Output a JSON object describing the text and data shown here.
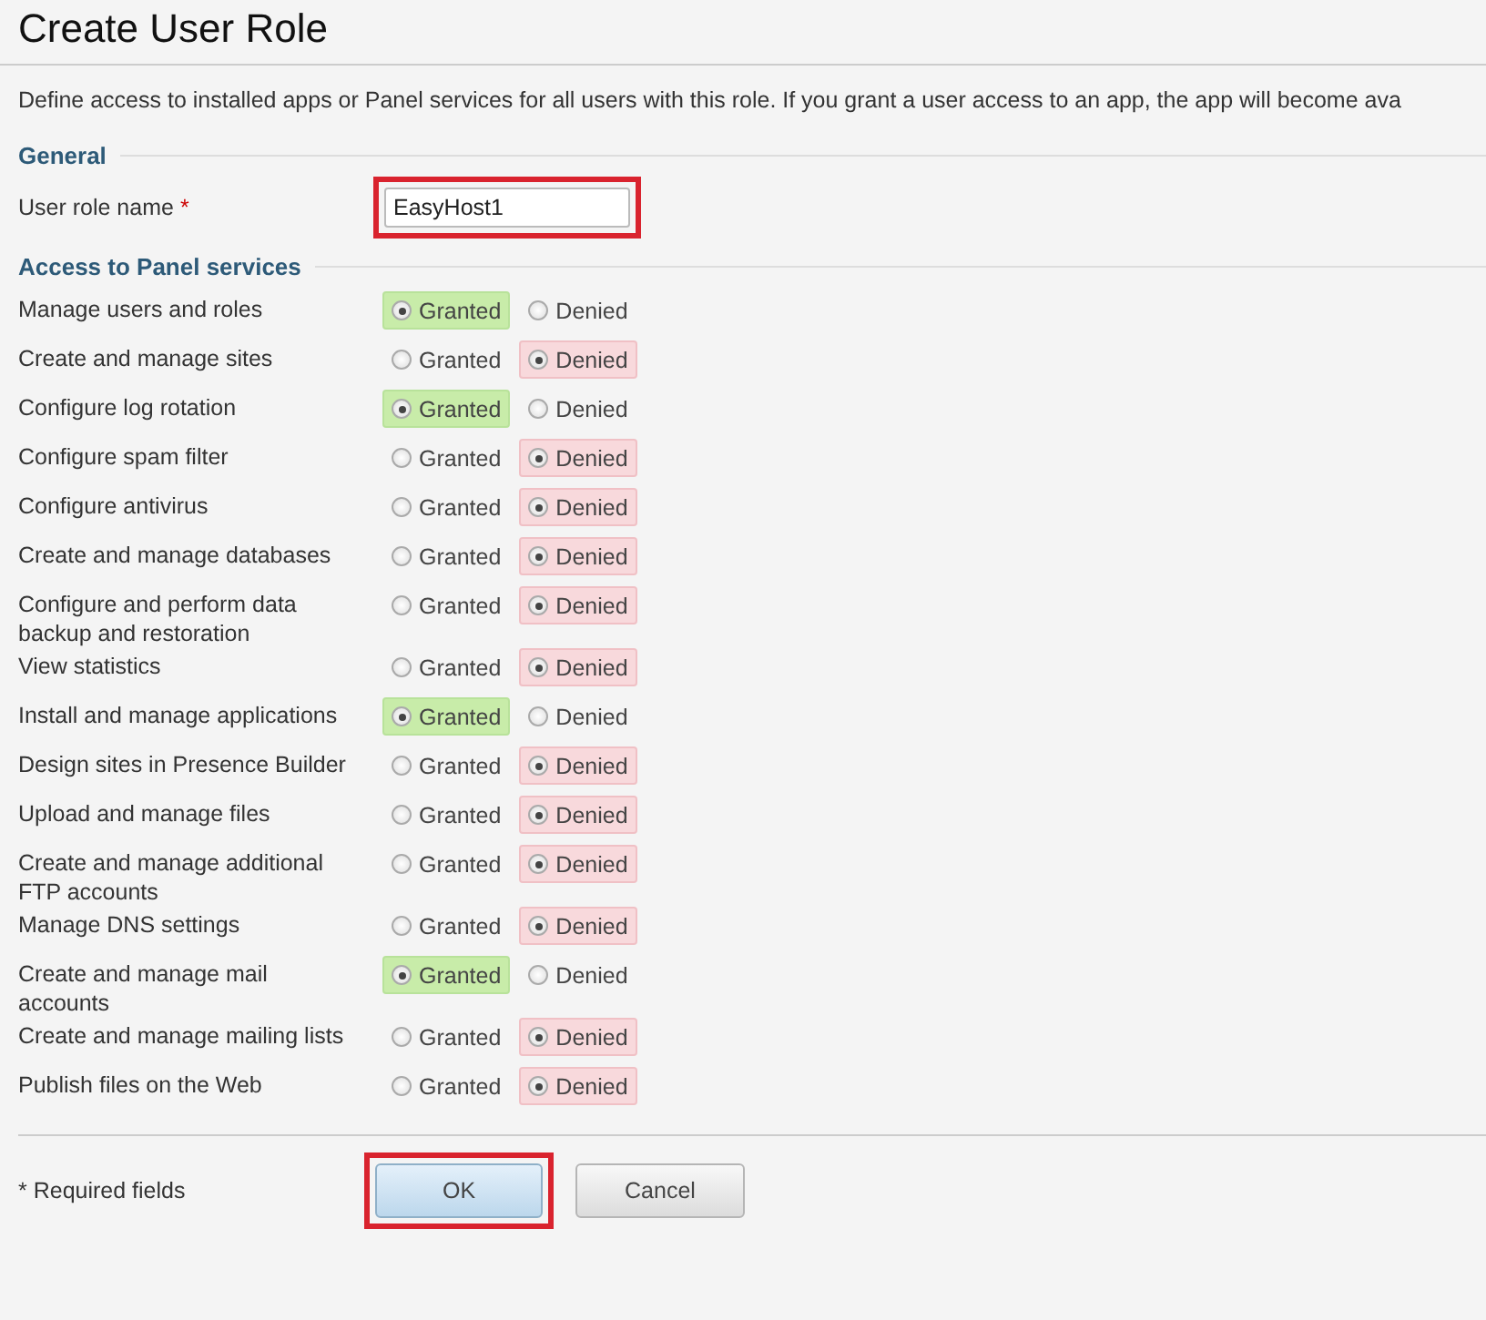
{
  "title": "Create User Role",
  "description": "Define access to installed apps or Panel services for all users with this role. If you grant a user access to an app, the app will become ava",
  "general": {
    "heading": "General",
    "field": {
      "label": "User role name",
      "required_mark": "*",
      "value": "EasyHost1",
      "highlighted": true
    }
  },
  "access": {
    "heading": "Access to Panel services",
    "permissions": [
      {
        "name": "Manage users and roles",
        "options": [
          {
            "label": "Granted",
            "kind": "grant",
            "selected": true
          },
          {
            "label": "Denied",
            "kind": "deny",
            "selected": false
          }
        ]
      },
      {
        "name": "Create and manage sites",
        "options": [
          {
            "label": "Granted",
            "kind": "grant",
            "selected": false
          },
          {
            "label": "Denied",
            "kind": "deny",
            "selected": true
          }
        ]
      },
      {
        "name": "Configure log rotation",
        "options": [
          {
            "label": "Granted",
            "kind": "grant",
            "selected": true
          },
          {
            "label": "Denied",
            "kind": "deny",
            "selected": false
          }
        ]
      },
      {
        "name": "Configure spam filter",
        "options": [
          {
            "label": "Granted",
            "kind": "grant",
            "selected": false
          },
          {
            "label": "Denied",
            "kind": "deny",
            "selected": true
          }
        ]
      },
      {
        "name": "Configure antivirus",
        "options": [
          {
            "label": "Granted",
            "kind": "grant",
            "selected": false
          },
          {
            "label": "Denied",
            "kind": "deny",
            "selected": true
          }
        ]
      },
      {
        "name": "Create and manage databases",
        "options": [
          {
            "label": "Granted",
            "kind": "grant",
            "selected": false
          },
          {
            "label": "Denied",
            "kind": "deny",
            "selected": true
          }
        ]
      },
      {
        "name": "Configure and perform data backup and restoration",
        "options": [
          {
            "label": "Granted",
            "kind": "grant",
            "selected": false
          },
          {
            "label": "Denied",
            "kind": "deny",
            "selected": true
          }
        ]
      },
      {
        "name": "View statistics",
        "options": [
          {
            "label": "Granted",
            "kind": "grant",
            "selected": false
          },
          {
            "label": "Denied",
            "kind": "deny",
            "selected": true
          }
        ]
      },
      {
        "name": "Install and manage applications",
        "options": [
          {
            "label": "Granted",
            "kind": "grant",
            "selected": true
          },
          {
            "label": "Denied",
            "kind": "deny",
            "selected": false
          }
        ]
      },
      {
        "name": "Design sites in Presence Builder",
        "options": [
          {
            "label": "Granted",
            "kind": "grant",
            "selected": false
          },
          {
            "label": "Denied",
            "kind": "deny",
            "selected": true
          }
        ]
      },
      {
        "name": "Upload and manage files",
        "options": [
          {
            "label": "Granted",
            "kind": "grant",
            "selected": false
          },
          {
            "label": "Denied",
            "kind": "deny",
            "selected": true
          }
        ]
      },
      {
        "name": "Create and manage additional FTP accounts",
        "options": [
          {
            "label": "Granted",
            "kind": "grant",
            "selected": false
          },
          {
            "label": "Denied",
            "kind": "deny",
            "selected": true
          }
        ]
      },
      {
        "name": "Manage DNS settings",
        "options": [
          {
            "label": "Granted",
            "kind": "grant",
            "selected": false
          },
          {
            "label": "Denied",
            "kind": "deny",
            "selected": true
          }
        ]
      },
      {
        "name": "Create and manage mail accounts",
        "options": [
          {
            "label": "Granted",
            "kind": "grant",
            "selected": true
          },
          {
            "label": "Denied",
            "kind": "deny",
            "selected": false
          }
        ]
      },
      {
        "name": "Create and manage mailing lists",
        "options": [
          {
            "label": "Granted",
            "kind": "grant",
            "selected": false
          },
          {
            "label": "Denied",
            "kind": "deny",
            "selected": true
          }
        ]
      },
      {
        "name": "Publish files on the Web",
        "options": [
          {
            "label": "Granted",
            "kind": "grant",
            "selected": false
          },
          {
            "label": "Denied",
            "kind": "deny",
            "selected": true
          }
        ]
      }
    ]
  },
  "footer": {
    "required_note": "* Required fields",
    "buttons": [
      {
        "label": "OK",
        "kind": "primary",
        "highlighted": true
      },
      {
        "label": "Cancel",
        "kind": "secondary",
        "highlighted": false
      }
    ]
  }
}
